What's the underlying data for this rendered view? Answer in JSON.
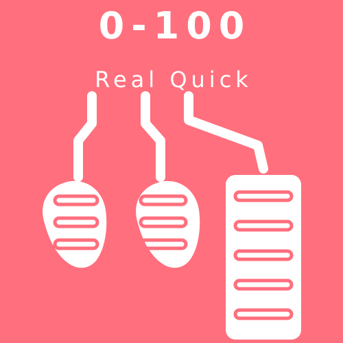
{
  "title": "0-100",
  "subtitle": "Real Quick",
  "colors": {
    "background": "#ff6f7d",
    "foreground": "#ffffff"
  },
  "icons": [
    "clutch-pedal-icon",
    "brake-pedal-icon",
    "accelerator-pedal-icon"
  ]
}
